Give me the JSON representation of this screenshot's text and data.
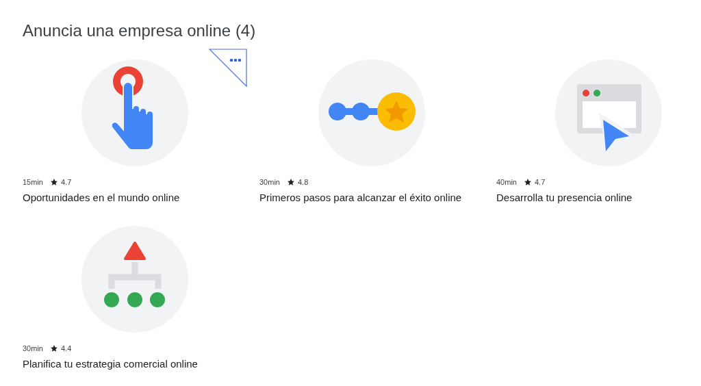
{
  "heading": "Anuncia una empresa online (4)",
  "courses": [
    {
      "kind": "tap",
      "duration": "15min",
      "rating": "4.7",
      "title": "Oportunidades en el mundo online"
    },
    {
      "kind": "steps",
      "duration": "30min",
      "rating": "4.8",
      "title": "Primeros pasos para alcanzar el éxito online"
    },
    {
      "kind": "browser",
      "duration": "40min",
      "rating": "4.7",
      "title": "Desarrolla tu presencia online"
    },
    {
      "kind": "hierarchy",
      "duration": "30min",
      "rating": "4.4",
      "title": "Planifica tu estrategia comercial online"
    }
  ]
}
